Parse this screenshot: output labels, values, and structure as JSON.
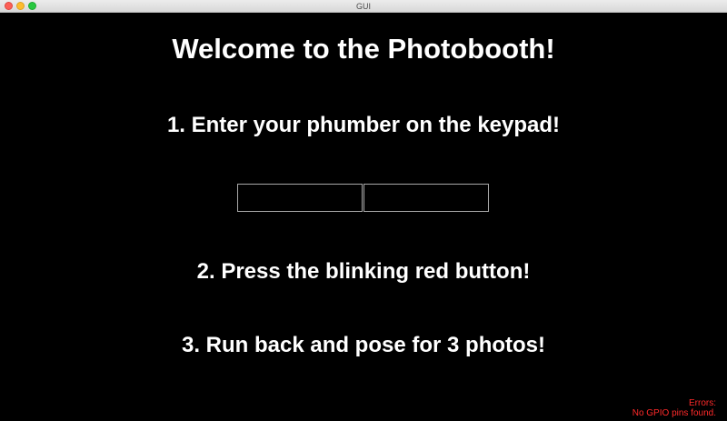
{
  "window": {
    "title": "GUI"
  },
  "main": {
    "title": "Welcome to the Photobooth!",
    "step1": "1. Enter your phumber on the keypad!",
    "step2": "2. Press the blinking red button!",
    "step3": "3. Run back and pose for 3 photos!",
    "phone_fields": [
      {
        "value": ""
      },
      {
        "value": ""
      }
    ]
  },
  "errors": {
    "label": "Errors:",
    "message": "No GPIO pins found."
  },
  "colors": {
    "background": "#000000",
    "text": "#ffffff",
    "error": "#ff2a2a"
  }
}
